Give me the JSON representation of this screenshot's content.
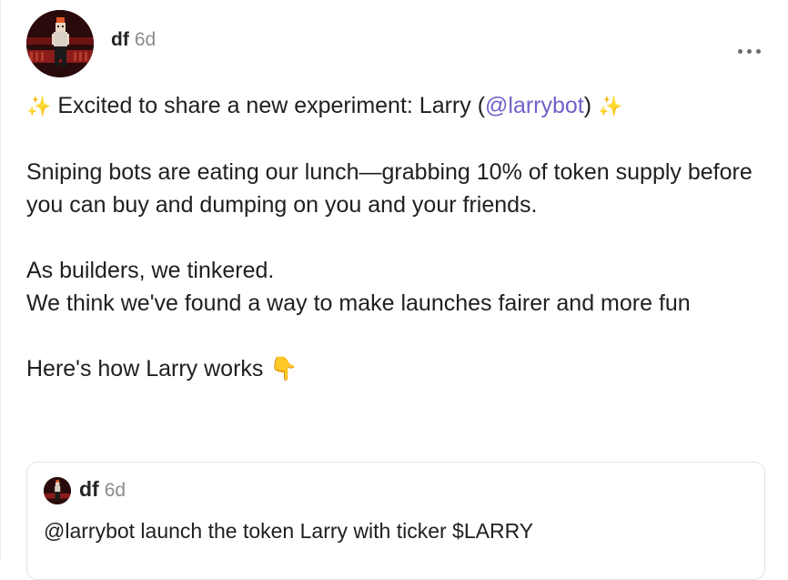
{
  "post": {
    "author": "df",
    "time": "6d",
    "more_label": "...",
    "line1_sparkle_left": "✨",
    "line1_text": "Excited to share a new experiment: Larry (",
    "line1_mention": "@larrybot",
    "line1_close": ")",
    "line1_sparkle_right": "✨",
    "para2": "Sniping bots are eating our lunch—grabbing 10% of token supply before you can buy and dumping on you and your friends.",
    "para3_line1": "As builders, we tinkered.",
    "para3_line2": "We think we've found a way to make launches fairer and more fun",
    "para4_text": "Here's how Larry works",
    "para4_emoji": "👇"
  },
  "quote": {
    "author": "df",
    "time": "6d",
    "text": "@larrybot launch the token Larry with ticker $LARRY"
  },
  "icons": {
    "avatar": "pixel-art-avatar",
    "more": "more-dots-icon"
  },
  "colors": {
    "mention": "#7360c9",
    "muted": "#8b8b8b",
    "avatar_bg": "#2a0b0b"
  }
}
